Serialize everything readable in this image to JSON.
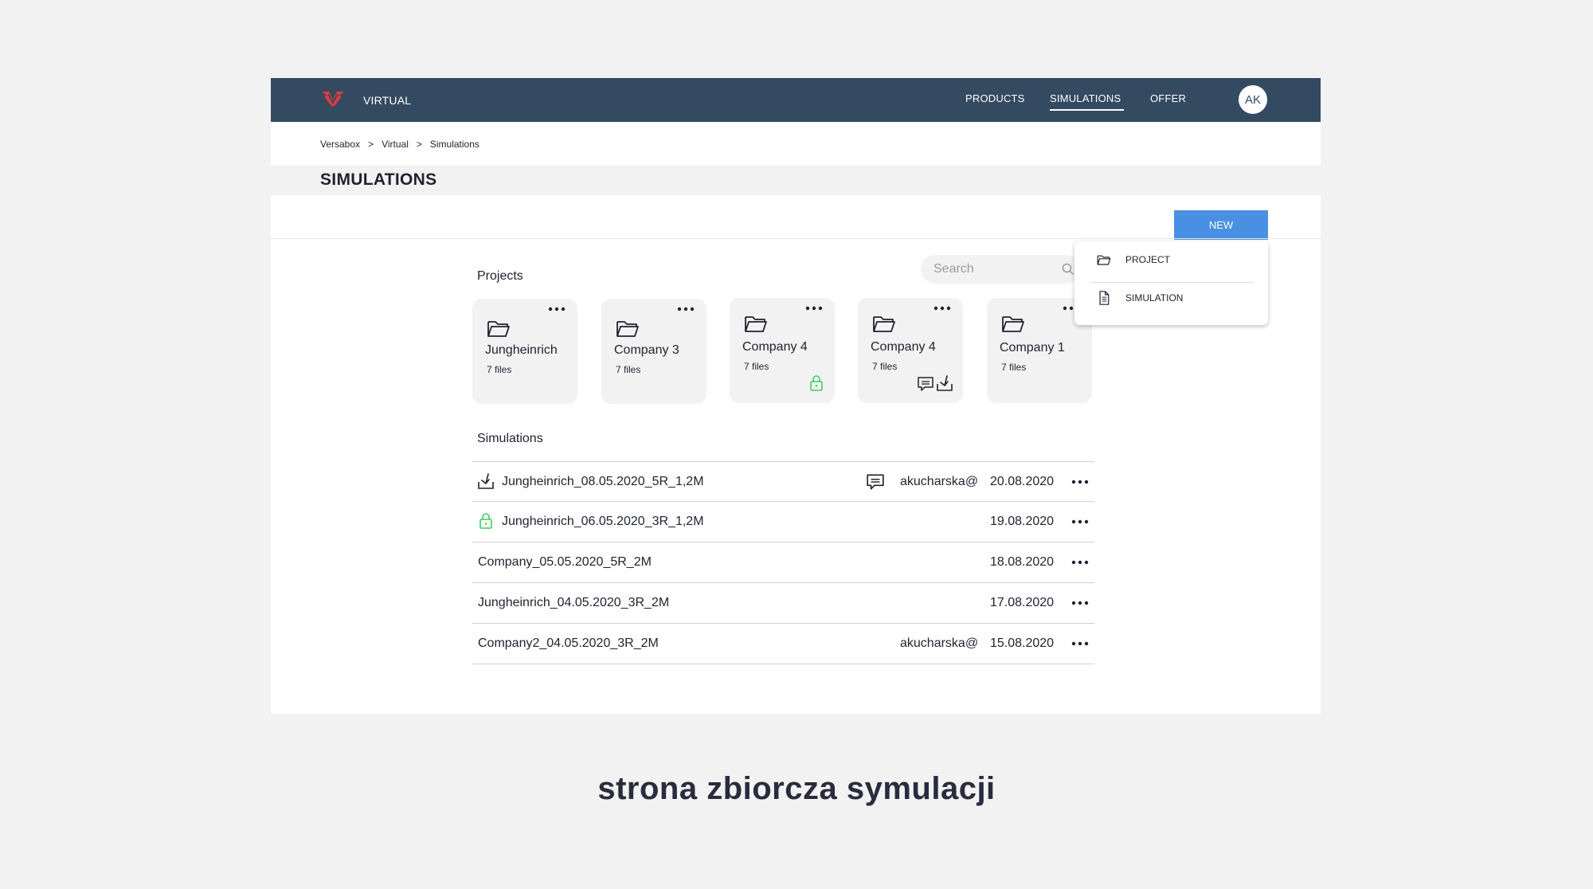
{
  "header": {
    "app_name": "VIRTUAL",
    "nav": [
      "PRODUCTS",
      "SIMULATIONS",
      "OFFER"
    ],
    "active_nav": "SIMULATIONS",
    "avatar_initials": "AK",
    "brand_color": "#e63a3a",
    "bar_color": "#344a61"
  },
  "breadcrumb": [
    "Versabox",
    "Virtual",
    "Simulations"
  ],
  "breadcrumb_separator": ">",
  "page_title": "SIMULATIONS",
  "toolbar": {
    "new_label": "NEW",
    "accent_color": "#4a90e2"
  },
  "new_menu": {
    "items": [
      {
        "label": "PROJECT",
        "icon": "folder-icon"
      },
      {
        "label": "SIMULATION",
        "icon": "document-icon"
      }
    ]
  },
  "projects": {
    "label": "Projects",
    "search_placeholder": "Search",
    "cards": [
      {
        "name": "Jungheinrich",
        "files": "7 files",
        "badges": []
      },
      {
        "name": "Company 3",
        "files": "7 files",
        "badges": []
      },
      {
        "name": "Company 4",
        "files": "7 files",
        "badges": [
          "lock-icon"
        ]
      },
      {
        "name": "Company 4",
        "files": "7 files",
        "badges": [
          "comment-icon",
          "download-icon"
        ]
      },
      {
        "name": "Company 1",
        "files": "7 files",
        "badges": []
      }
    ]
  },
  "simulations": {
    "label": "Simulations",
    "rows": [
      {
        "name": "Jungheinrich_08.05.2020_5R_1,2M",
        "icon": "download-icon",
        "comment": true,
        "user": "akucharska@",
        "date": "20.08.2020"
      },
      {
        "name": "Jungheinrich_06.05.2020_3R_1,2M",
        "icon": "lock-icon",
        "comment": false,
        "user": "",
        "date": "19.08.2020"
      },
      {
        "name": "Company_05.05.2020_5R_2M",
        "icon": "",
        "comment": false,
        "user": "",
        "date": "18.08.2020"
      },
      {
        "name": "Jungheinrich_04.05.2020_3R_2M",
        "icon": "",
        "comment": false,
        "user": "",
        "date": "17.08.2020"
      },
      {
        "name": "Company2_04.05.2020_3R_2M",
        "icon": "",
        "comment": false,
        "user": "akucharska@",
        "date": "15.08.2020"
      }
    ]
  },
  "caption": "strona zbiorcza symulacji",
  "lock_color": "#3ecf5a"
}
